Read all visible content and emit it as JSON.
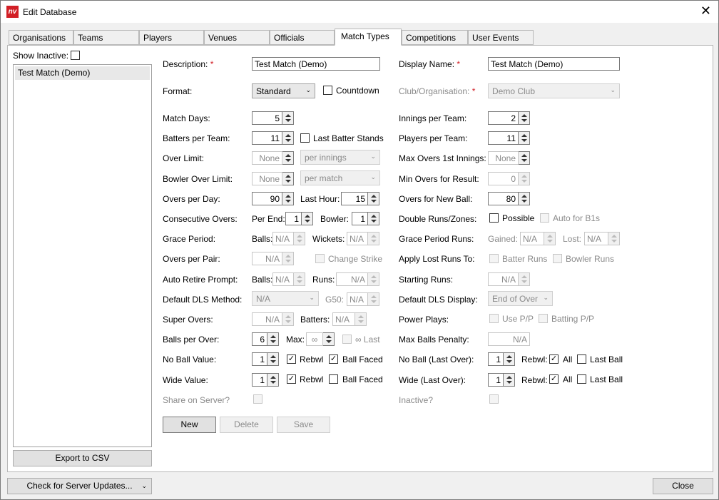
{
  "window": {
    "title": "Edit Database",
    "logo": "nv"
  },
  "tabs": [
    "Organisations",
    "Teams",
    "Players",
    "Venues",
    "Officials",
    "Match Types",
    "Competitions",
    "User Events"
  ],
  "sidebar": {
    "show_inactive": "Show Inactive:",
    "items": [
      "Test Match (Demo)"
    ],
    "export": "Export to CSV"
  },
  "left": {
    "description": {
      "label": "Description:",
      "value": "Test Match (Demo)"
    },
    "format": {
      "label": "Format:",
      "value": "Standard",
      "countdown": "Countdown"
    },
    "match_days": {
      "label": "Match Days:",
      "value": "5"
    },
    "batters": {
      "label": "Batters per Team:",
      "value": "11",
      "last_batter": "Last Batter Stands"
    },
    "over_limit": {
      "label": "Over Limit:",
      "value": "None",
      "unit": "per innings"
    },
    "bowler_limit": {
      "label": "Bowler Over Limit:",
      "value": "None",
      "unit": "per match"
    },
    "overs_day": {
      "label": "Overs per Day:",
      "value": "90",
      "last_hour": "Last Hour:",
      "last_hour_value": "15"
    },
    "consecutive": {
      "label": "Consecutive Overs:",
      "per_end": "Per End:",
      "per_end_value": "1",
      "bowler": "Bowler:",
      "bowler_value": "1"
    },
    "grace": {
      "label": "Grace Period:",
      "balls": "Balls:",
      "balls_value": "N/A",
      "wickets": "Wickets:",
      "wickets_value": "N/A"
    },
    "overs_pair": {
      "label": "Overs per Pair:",
      "value": "N/A",
      "change_strike": "Change Strike"
    },
    "auto_retire": {
      "label": "Auto Retire Prompt:",
      "balls": "Balls:",
      "balls_value": "N/A",
      "runs": "Runs:",
      "runs_value": "N/A"
    },
    "dls": {
      "label": "Default DLS Method:",
      "value": "N/A",
      "g50": "G50:",
      "g50_value": "N/A"
    },
    "super_overs": {
      "label": "Super Overs:",
      "value": "N/A",
      "batters": "Batters:",
      "batters_value": "N/A"
    },
    "balls_over": {
      "label": "Balls per Over:",
      "value": "6",
      "max": "Max:",
      "max_value": "∞",
      "last": "∞ Last"
    },
    "no_ball": {
      "label": "No Ball Value:",
      "value": "1",
      "rebwl": "Rebwl",
      "ball_faced": "Ball Faced"
    },
    "wide": {
      "label": "Wide Value:",
      "value": "1",
      "rebwl": "Rebwl",
      "ball_faced": "Ball Faced"
    },
    "share": {
      "label": "Share on Server?"
    }
  },
  "right": {
    "display_name": {
      "label": "Display Name:",
      "value": "Test Match (Demo)"
    },
    "club": {
      "label": "Club/Organisation:",
      "value": "Demo Club"
    },
    "innings": {
      "label": "Innings per Team:",
      "value": "2"
    },
    "players": {
      "label": "Players per Team:",
      "value": "11"
    },
    "max_overs": {
      "label": "Max Overs 1st Innings:",
      "value": "None"
    },
    "min_overs": {
      "label": "Min Overs for Result:",
      "value": "0"
    },
    "new_ball": {
      "label": "Overs for New Ball:",
      "value": "80"
    },
    "double_runs": {
      "label": "Double Runs/Zones:",
      "possible": "Possible",
      "auto": "Auto for B1s"
    },
    "grace_runs": {
      "label": "Grace Period Runs:",
      "gained": "Gained:",
      "gained_value": "N/A",
      "lost": "Lost:",
      "lost_value": "N/A"
    },
    "lost_runs": {
      "label": "Apply Lost Runs To:",
      "batter": "Batter Runs",
      "bowler": "Bowler Runs"
    },
    "starting_runs": {
      "label": "Starting Runs:",
      "value": "N/A"
    },
    "dls_display": {
      "label": "Default DLS Display:",
      "value": "End of Over"
    },
    "power_plays": {
      "label": "Power Plays:",
      "use": "Use P/P",
      "batting": "Batting P/P"
    },
    "max_balls": {
      "label": "Max Balls Penalty:",
      "value": "N/A"
    },
    "no_ball_last": {
      "label": "No Ball (Last Over):",
      "value": "1",
      "rebwl": "Rebwl:",
      "all": "All",
      "last_ball": "Last Ball"
    },
    "wide_last": {
      "label": "Wide (Last Over):",
      "value": "1",
      "rebwl": "Rebwl:",
      "all": "All",
      "last_ball": "Last Ball"
    },
    "inactive": {
      "label": "Inactive?"
    }
  },
  "actions": {
    "new": "New",
    "delete": "Delete",
    "save": "Save"
  },
  "footer": {
    "check": "Check for Server Updates...",
    "close": "Close"
  }
}
